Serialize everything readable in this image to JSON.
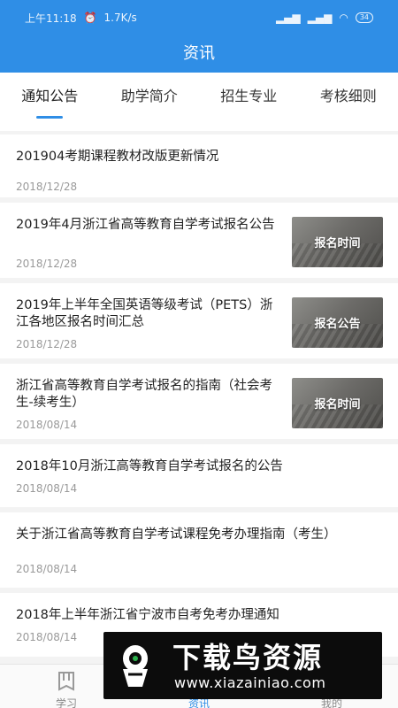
{
  "status": {
    "time": "上午11:18",
    "speed": "1.7K/s",
    "battery": "34"
  },
  "header": {
    "title": "资讯"
  },
  "tabs": [
    {
      "label": "通知公告",
      "active": true
    },
    {
      "label": "助学简介",
      "active": false
    },
    {
      "label": "招生专业",
      "active": false
    },
    {
      "label": "考核细则",
      "active": false
    }
  ],
  "news": [
    {
      "title": "201904考期课程教材改版更新情况",
      "date": "2018/12/28",
      "thumb": ""
    },
    {
      "title": "2019年4月浙江省高等教育自学考试报名公告",
      "date": "2018/12/28",
      "thumb": "报名时间"
    },
    {
      "title": "2019年上半年全国英语等级考试（PETS）浙江各地区报名时间汇总",
      "date": "2018/12/28",
      "thumb": "报名公告"
    },
    {
      "title": "浙江省高等教育自学考试报名的指南（社会考生-续考生）",
      "date": "2018/08/14",
      "thumb": "报名时间"
    },
    {
      "title": "2018年10月浙江高等教育自学考试报名的公告",
      "date": "2018/08/14",
      "thumb": ""
    },
    {
      "title": "关于浙江省高等教育自学考试课程免考办理指南（考生）",
      "date": "2018/08/14",
      "thumb": ""
    },
    {
      "title": "2018年上半年浙江省宁波市自考免考办理通知",
      "date": "2018/08/14",
      "thumb": ""
    }
  ],
  "bottom_nav": [
    {
      "label": "学习",
      "icon": "book-icon",
      "active": false
    },
    {
      "label": "资讯",
      "icon": "news-icon",
      "active": true
    },
    {
      "label": "我的",
      "icon": "user-icon",
      "active": false
    }
  ],
  "watermark": {
    "big": "下载鸟资源",
    "small": "www.xiazainiao.com"
  },
  "colors": {
    "primary": "#2f8ee6",
    "background": "#f3f3f3"
  }
}
